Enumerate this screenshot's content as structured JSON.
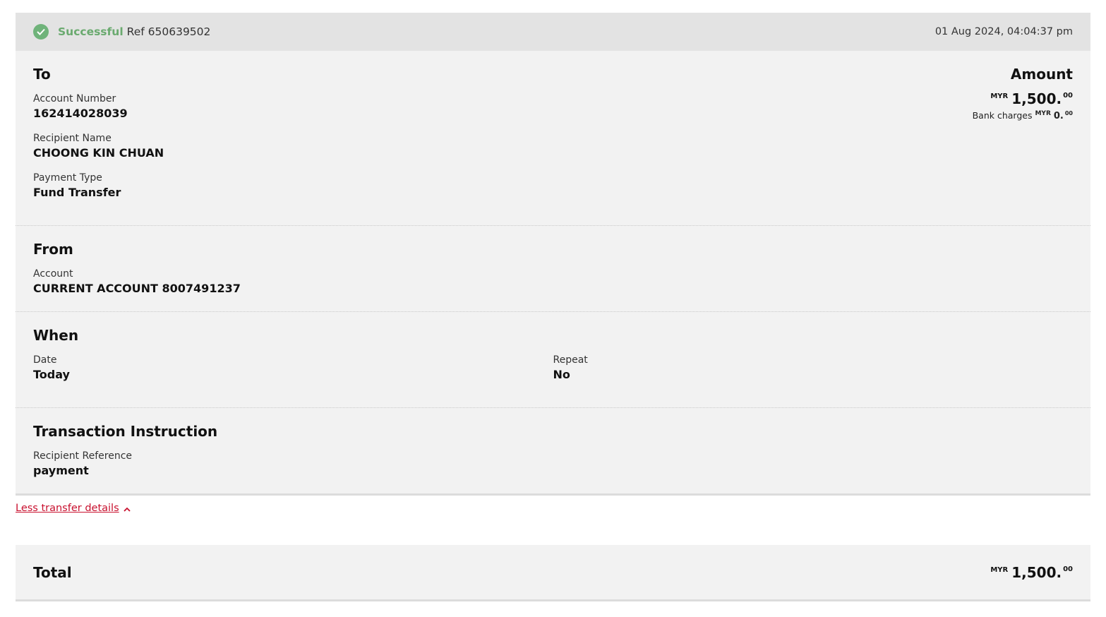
{
  "status": {
    "icon": "check-circle-icon",
    "label": "Successful",
    "ref": "Ref 650639502",
    "timestamp": "01 Aug 2024, 04:04:37 pm",
    "color": "#6aaa6f"
  },
  "to": {
    "title": "To",
    "account_number_label": "Account Number",
    "account_number": "162414028039",
    "recipient_name_label": "Recipient Name",
    "recipient_name": "CHOONG KIN CHUAN",
    "payment_type_label": "Payment Type",
    "payment_type": "Fund Transfer"
  },
  "amount": {
    "title": "Amount",
    "currency": "MYR",
    "whole": "1,500.",
    "cents": "00",
    "bank_charges_label": "Bank charges",
    "bank_charges_currency": "MYR",
    "bank_charges_whole": "0.",
    "bank_charges_cents": "00"
  },
  "from": {
    "title": "From",
    "account_label": "Account",
    "account": "CURRENT ACCOUNT 8007491237"
  },
  "when": {
    "title": "When",
    "date_label": "Date",
    "date": "Today",
    "repeat_label": "Repeat",
    "repeat": "No"
  },
  "instruction": {
    "title": "Transaction Instruction",
    "reference_label": "Recipient Reference",
    "reference": "payment"
  },
  "toggle": {
    "label": "Less transfer details",
    "icon": "chevron-up-icon",
    "color": "#c8102e"
  },
  "total": {
    "title": "Total",
    "currency": "MYR",
    "whole": "1,500.",
    "cents": "00"
  }
}
